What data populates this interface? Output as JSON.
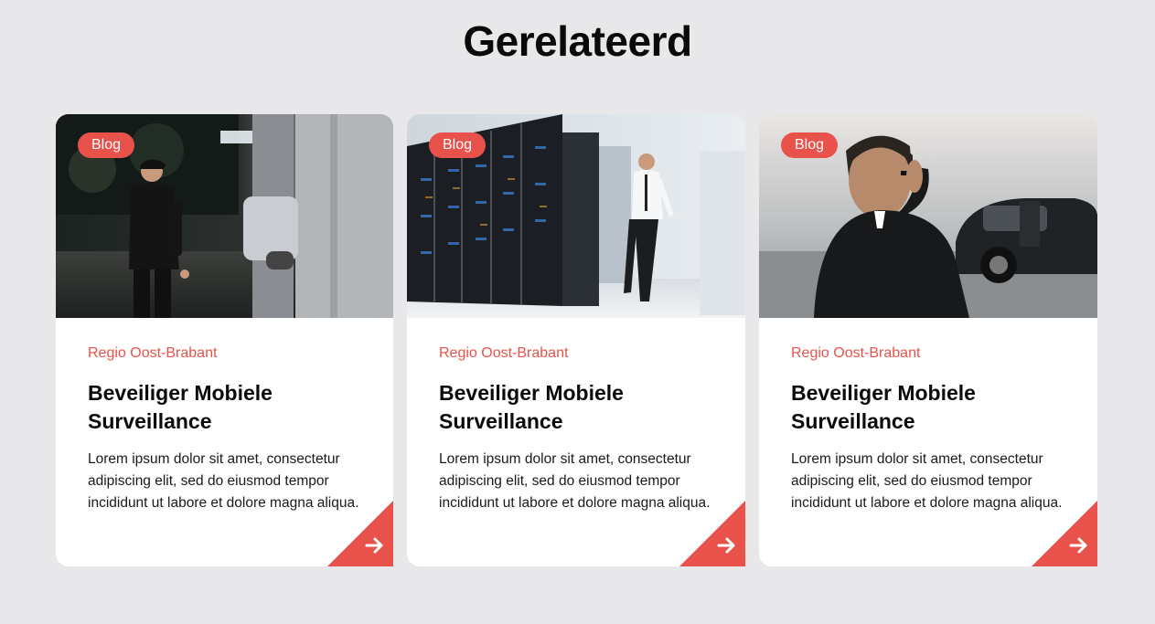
{
  "section": {
    "title": "Gerelateerd"
  },
  "cards": [
    {
      "badge": "Blog",
      "region": "Regio Oost-Brabant",
      "title": "Beveiliger Mobiele Surveillance",
      "text": "Lorem ipsum dolor sit amet, consectetur adipiscing elit, sed do eiusmod tempor incididunt ut labore et dolore magna aliqua.",
      "image": "security-guard-at-night-photo",
      "arrow_icon": "arrow-right-icon"
    },
    {
      "badge": "Blog",
      "region": "Regio Oost-Brabant",
      "title": "Beveiliger Mobiele Surveillance",
      "text": "Lorem ipsum dolor sit amet, consectetur adipiscing elit, sed do eiusmod tempor incididunt ut labore et dolore magna aliqua.",
      "image": "server-room-guard-photo",
      "arrow_icon": "arrow-right-icon"
    },
    {
      "badge": "Blog",
      "region": "Regio Oost-Brabant",
      "title": "Beveiliger Mobiele Surveillance",
      "text": "Lorem ipsum dolor sit amet, consectetur adipiscing elit, sed do eiusmod tempor incididunt ut labore et dolore magna aliqua.",
      "image": "bodyguard-with-earpiece-photo",
      "arrow_icon": "arrow-right-icon"
    }
  ],
  "colors": {
    "accent": "#e8524a",
    "background": "#e8e8ea",
    "card": "#ffffff",
    "text": "#0a0a0a"
  }
}
